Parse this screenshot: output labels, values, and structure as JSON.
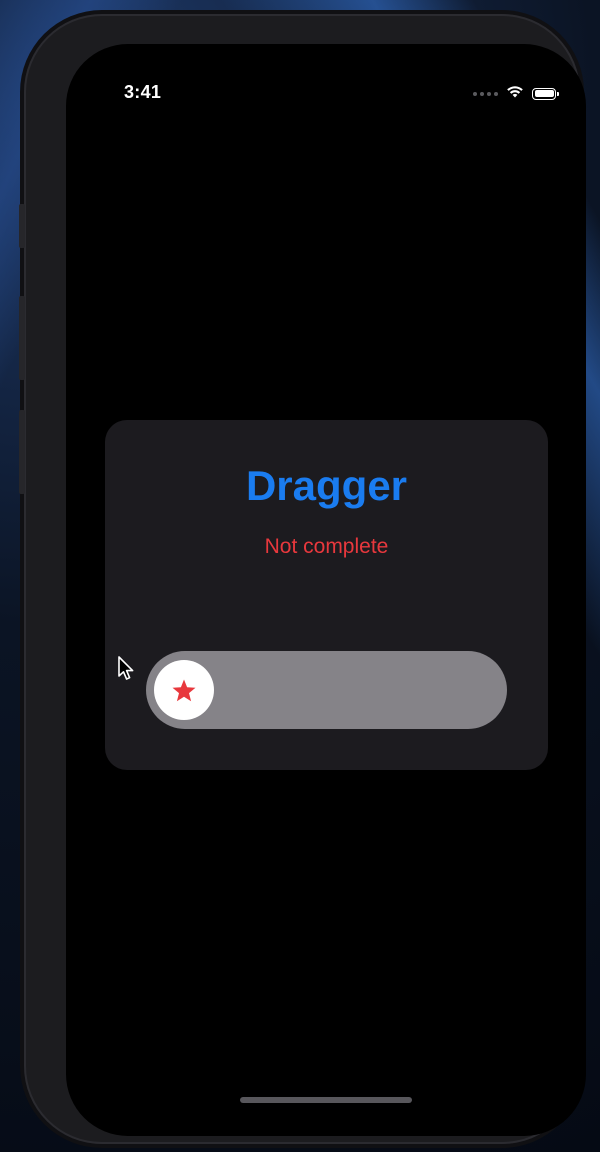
{
  "status_bar": {
    "time": "3:41"
  },
  "card": {
    "title": "Dragger",
    "status": "Not complete"
  },
  "slider": {
    "progress": 0,
    "knob_icon": "star-icon"
  },
  "colors": {
    "title": "#1a7cf0",
    "status": "#e8383d",
    "card_background": "#1c1b1f",
    "track": "#858388",
    "knob": "#ffffff",
    "star": "#e8383d"
  }
}
